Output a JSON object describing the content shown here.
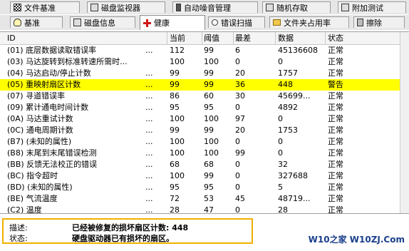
{
  "tabs_top": [
    {
      "label": "文件基准",
      "icon": "checker-flag-icon"
    },
    {
      "label": "磁盘监视器",
      "icon": "disk-monitor-icon"
    },
    {
      "label": "自动噪音管理",
      "icon": "speaker-icon"
    },
    {
      "label": "随机存取",
      "icon": "random-access-icon"
    },
    {
      "label": "附加测试",
      "icon": "extra-test-icon"
    }
  ],
  "tabs_bottom": [
    {
      "label": "基准",
      "icon": "lightbulb-icon"
    },
    {
      "label": "磁盘信息",
      "icon": "disk-info-icon"
    },
    {
      "label": "健康",
      "icon": "health-cross-icon"
    },
    {
      "label": "错误扫描",
      "icon": "magnifier-icon"
    },
    {
      "label": "文件夹占用率",
      "icon": "folder-icon"
    },
    {
      "label": "擦除",
      "icon": "trash-icon"
    }
  ],
  "columns": {
    "id": "ID",
    "current": "当前",
    "threshold": "阈值",
    "worst": "最差",
    "data": "数据",
    "status": "状态"
  },
  "rows": [
    {
      "id": "(01) 底层数据读取错误率",
      "dots": "...",
      "current": "112",
      "threshold": "99",
      "worst": "6",
      "data": "45136608",
      "status": "正常"
    },
    {
      "id": "(03) 马达旋转到标准转速所需时...",
      "dots": "",
      "current": "100",
      "threshold": "100",
      "worst": "0",
      "data": "0",
      "status": "正常"
    },
    {
      "id": "(04) 马达启动/停止计数",
      "dots": "...",
      "current": "99",
      "threshold": "99",
      "worst": "20",
      "data": "1757",
      "status": "正常"
    },
    {
      "id": "(05) 重映射扇区计数",
      "dots": "...",
      "current": "99",
      "threshold": "99",
      "worst": "36",
      "data": "448",
      "status": "警告",
      "warn": true
    },
    {
      "id": "(07) 寻道错误率",
      "dots": "...",
      "current": "86",
      "threshold": "60",
      "worst": "30",
      "data": "45699...",
      "status": "正常"
    },
    {
      "id": "(09) 累计通电时间计数",
      "dots": "...",
      "current": "95",
      "threshold": "95",
      "worst": "0",
      "data": "4892",
      "status": "正常"
    },
    {
      "id": "(0A) 马达重试计数",
      "dots": "...",
      "current": "100",
      "threshold": "100",
      "worst": "97",
      "data": "0",
      "status": "正常"
    },
    {
      "id": "(0C) 通电周期计数",
      "dots": "...",
      "current": "99",
      "threshold": "99",
      "worst": "20",
      "data": "1753",
      "status": "正常"
    },
    {
      "id": "(B7) (未知的属性)",
      "dots": "...",
      "current": "100",
      "threshold": "100",
      "worst": "0",
      "data": "0",
      "status": "正常"
    },
    {
      "id": "(B8) 末尾到末尾错误检测",
      "dots": "...",
      "current": "100",
      "threshold": "100",
      "worst": "99",
      "data": "0",
      "status": "正常"
    },
    {
      "id": "(BB) 反馈无法校正的错误",
      "dots": "...",
      "current": "68",
      "threshold": "68",
      "worst": "0",
      "data": "32",
      "status": "正常"
    },
    {
      "id": "(BC) 指令超时",
      "dots": "...",
      "current": "100",
      "threshold": "99",
      "worst": "0",
      "data": "327688",
      "status": "正常"
    },
    {
      "id": "(BD) (未知的属性)",
      "dots": "...",
      "current": "95",
      "threshold": "95",
      "worst": "0",
      "data": "5",
      "status": "正常"
    },
    {
      "id": "(BE) 气流温度",
      "dots": "...",
      "current": "72",
      "threshold": "53",
      "worst": "45",
      "data": "48719...",
      "status": "正常"
    },
    {
      "id": "(C2) 温度",
      "dots": "...",
      "current": "28",
      "threshold": "47",
      "worst": "0",
      "data": "28",
      "status": "正常"
    }
  ],
  "info": {
    "desc_label": "描述:",
    "desc_value": "已经被修复的损坏扇区计数: 448",
    "status_label": "状态:",
    "status_value": "硬盘驱动器已有损坏的扇区。"
  },
  "watermark": "W10之家 W10ZJ.Com",
  "colors": {
    "warning_row": "#ffff00",
    "info_border": "#f0b000",
    "watermark": "#1a3f8c"
  }
}
